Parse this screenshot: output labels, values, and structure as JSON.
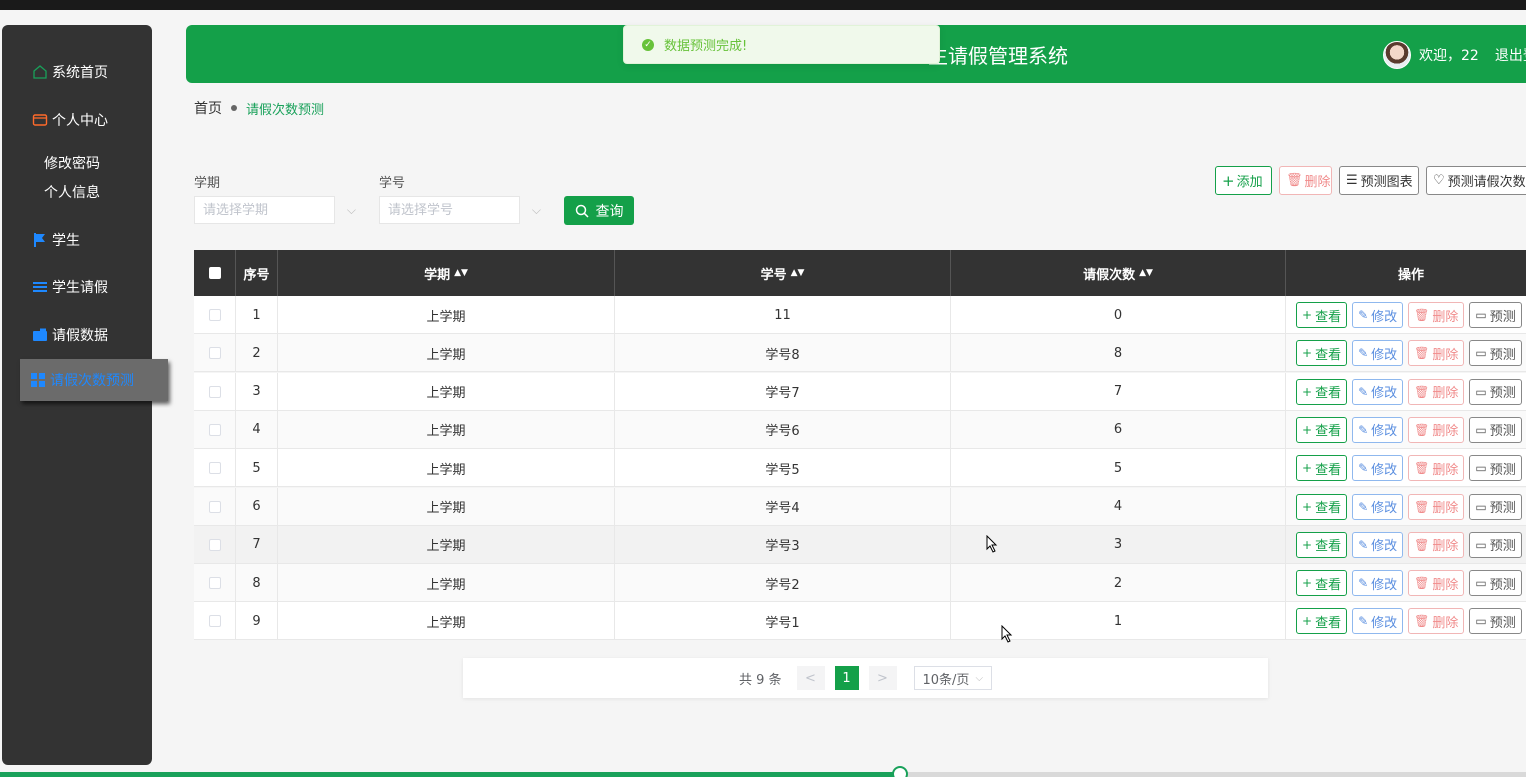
{
  "header": {
    "title": "生请假管理系统",
    "welcome": "欢迎，22",
    "logout": "退出登"
  },
  "toast": {
    "message": "数据预测完成!"
  },
  "sidebar": {
    "items": [
      {
        "label": "系统首页",
        "icon": "home-icon"
      },
      {
        "label": "个人中心",
        "icon": "wallet-icon"
      },
      {
        "label": "学生",
        "icon": "flag-icon"
      },
      {
        "label": "学生请假",
        "icon": "list-icon"
      },
      {
        "label": "请假数据",
        "icon": "folder-icon"
      },
      {
        "label": "请假次数预测",
        "icon": "grid-icon",
        "active": true
      }
    ],
    "sub": [
      "修改密码",
      "个人信息"
    ]
  },
  "breadcrumb": {
    "home": "首页",
    "current": "请假次数预测"
  },
  "search": {
    "term_label": "学期",
    "term_placeholder": "请选择学期",
    "id_label": "学号",
    "id_placeholder": "请选择学号",
    "query": "查询"
  },
  "toolbar": {
    "add": "添加",
    "delete": "删除",
    "chart": "预测图表",
    "predict": "预测请假次数"
  },
  "table": {
    "headers": [
      "序号",
      "学期",
      "学号",
      "请假次数",
      "操作"
    ],
    "rows": [
      {
        "no": "1",
        "term": "上学期",
        "id": "11",
        "count": "0"
      },
      {
        "no": "2",
        "term": "上学期",
        "id": "学号8",
        "count": "8"
      },
      {
        "no": "3",
        "term": "上学期",
        "id": "学号7",
        "count": "7"
      },
      {
        "no": "4",
        "term": "上学期",
        "id": "学号6",
        "count": "6"
      },
      {
        "no": "5",
        "term": "上学期",
        "id": "学号5",
        "count": "5"
      },
      {
        "no": "6",
        "term": "上学期",
        "id": "学号4",
        "count": "4"
      },
      {
        "no": "7",
        "term": "上学期",
        "id": "学号3",
        "count": "3"
      },
      {
        "no": "8",
        "term": "上学期",
        "id": "学号2",
        "count": "2"
      },
      {
        "no": "9",
        "term": "上学期",
        "id": "学号1",
        "count": "1"
      }
    ],
    "ops": {
      "view": "查看",
      "edit": "修改",
      "del": "删除",
      "pred": "预测"
    }
  },
  "pager": {
    "total": "共 9 条",
    "prev": "<",
    "page": "1",
    "next": ">",
    "size": "10条/页"
  },
  "video_progress": 0.59,
  "colors": {
    "brand": "#14a049",
    "sidebar": "#333333",
    "active_text": "#1e88ff"
  }
}
